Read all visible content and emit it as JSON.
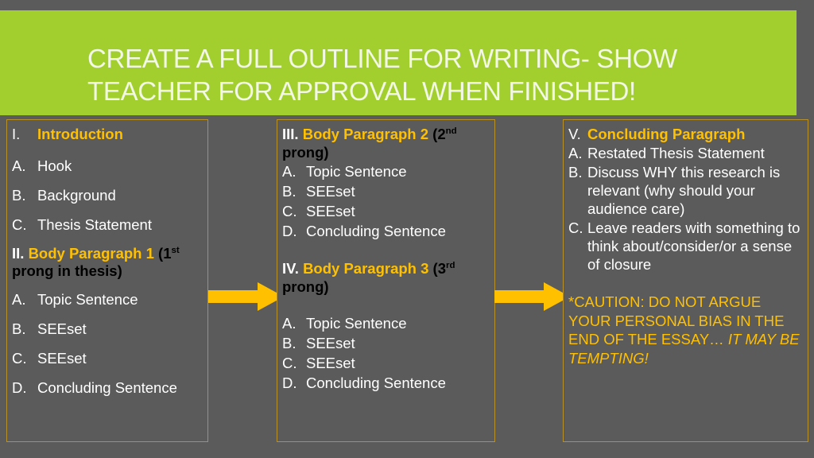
{
  "slide": {
    "background_color": "#5B5B5B",
    "banner_color": "#A2CE2E",
    "accent_color": "#FFC000",
    "border_color": "#B8902C",
    "title": "CREATE A FULL OUTLINE FOR WRITING- SHOW\nTEACHER FOR APPROVAL WHEN FINISHED!"
  },
  "columns": [
    {
      "id": "column-1",
      "sections": [
        {
          "numeral": "I.",
          "heading": "Introduction",
          "heading_suffix": "",
          "items": [
            {
              "mark": "A.",
              "text": "Hook"
            },
            {
              "mark": "B.",
              "text": "Background"
            },
            {
              "mark": "C.",
              "text": "Thesis Statement"
            }
          ]
        },
        {
          "numeral": "II.",
          "heading": "Body Paragraph 1",
          "heading_suffix": " (1st prong in thesis)",
          "heading_suffix_ordinal": "1",
          "heading_suffix_sup": "st",
          "heading_suffix_rest": " prong in thesis)",
          "items": [
            {
              "mark": "A.",
              "text": "Topic Sentence"
            },
            {
              "mark": "B.",
              "text": "SEEset"
            },
            {
              "mark": "C.",
              "text": "SEEset"
            },
            {
              "mark": "D.",
              "text": "Concluding Sentence"
            }
          ]
        }
      ]
    },
    {
      "id": "column-2",
      "sections": [
        {
          "numeral": "III.",
          "heading": "Body Paragraph 2",
          "heading_suffix_ordinal": "2",
          "heading_suffix_sup": "nd",
          "heading_suffix_rest": " prong)",
          "items": [
            {
              "mark": "A.",
              "text": "Topic Sentence"
            },
            {
              "mark": "B.",
              "text": "SEEset"
            },
            {
              "mark": "C.",
              "text": "SEEset"
            },
            {
              "mark": "D.",
              "text": "Concluding Sentence"
            }
          ]
        },
        {
          "numeral": "IV.",
          "heading": "Body Paragraph 3",
          "heading_suffix_ordinal": "3",
          "heading_suffix_sup": "rd",
          "heading_suffix_rest": " prong)",
          "items": [
            {
              "mark": "A.",
              "text": "Topic Sentence"
            },
            {
              "mark": "B.",
              "text": "SEEset"
            },
            {
              "mark": "C.",
              "text": "SEEset"
            },
            {
              "mark": "D.",
              "text": "Concluding Sentence"
            }
          ]
        }
      ]
    },
    {
      "id": "column-3",
      "sections": [
        {
          "numeral": "V.",
          "heading": "Concluding Paragraph",
          "items": [
            {
              "mark": "A.",
              "text": "Restated Thesis Statement"
            },
            {
              "mark": "B.",
              "text": "Discuss WHY this research is relevant (why should your audience care)"
            },
            {
              "mark": "C.",
              "text": "Leave readers with something to think about/consider/or a sense of closure"
            }
          ]
        }
      ],
      "caution": {
        "upright": "*CAUTION: DO NOT ARGUE YOUR PERSONAL BIAS IN THE END OF THE ESSAY… ",
        "italic": "IT MAY BE TEMPTING!"
      }
    }
  ],
  "arrows": [
    {
      "id": "arrow-1-to-2",
      "color": "#FFC000"
    },
    {
      "id": "arrow-2-to-3",
      "color": "#FFC000"
    }
  ]
}
